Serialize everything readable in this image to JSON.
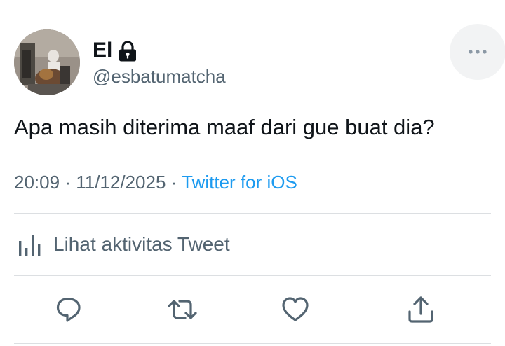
{
  "author": {
    "display_name": "El",
    "handle": "@esbatumatcha",
    "protected_icon": "lock-icon",
    "avatar": "profile-photo"
  },
  "tweet": {
    "text": "Apa masih diterima maaf dari gue buat dia?",
    "time": "20:09",
    "separator": "·",
    "date": "11/12/2025",
    "source": "Twitter for iOS"
  },
  "activity": {
    "label": "Lihat aktivitas Tweet",
    "icon": "bar-chart-icon"
  },
  "actions": [
    {
      "name": "reply",
      "icon": "comment-icon"
    },
    {
      "name": "retweet",
      "icon": "retweet-icon"
    },
    {
      "name": "like",
      "icon": "heart-icon"
    },
    {
      "name": "share",
      "icon": "share-icon"
    }
  ],
  "colors": {
    "text_primary": "#0f1419",
    "text_secondary": "#536471",
    "link": "#1d9bf0",
    "divider": "#dcdfe2",
    "more_bg": "#f2f3f4"
  }
}
